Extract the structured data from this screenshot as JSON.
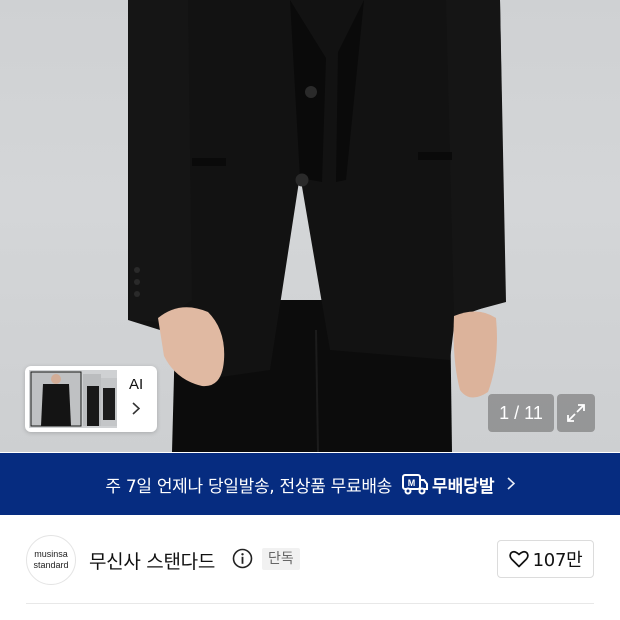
{
  "product_image": {
    "alt_icon": "product-photo",
    "thumbnail_ai_label": "AI",
    "thumbnail_chevron": "chevron-right-icon",
    "pager_text": "1 / 11",
    "expand_icon": "expand-icon"
  },
  "banner": {
    "text": "주 7일 언제나 당일발송, 전상품 무료배송",
    "delivery_label": "무배당발",
    "delivery_icon_letter": "M",
    "chevron_icon": "chevron-right-icon"
  },
  "brand": {
    "logo_line1": "musinsa",
    "logo_line2": "standard",
    "name": "무신사 스탠다드",
    "info_icon": "info-icon",
    "badge": "단독",
    "like_icon": "heart-icon",
    "like_count": "107만"
  },
  "colors": {
    "banner_bg": "#062c80",
    "background": "#ffffff"
  }
}
